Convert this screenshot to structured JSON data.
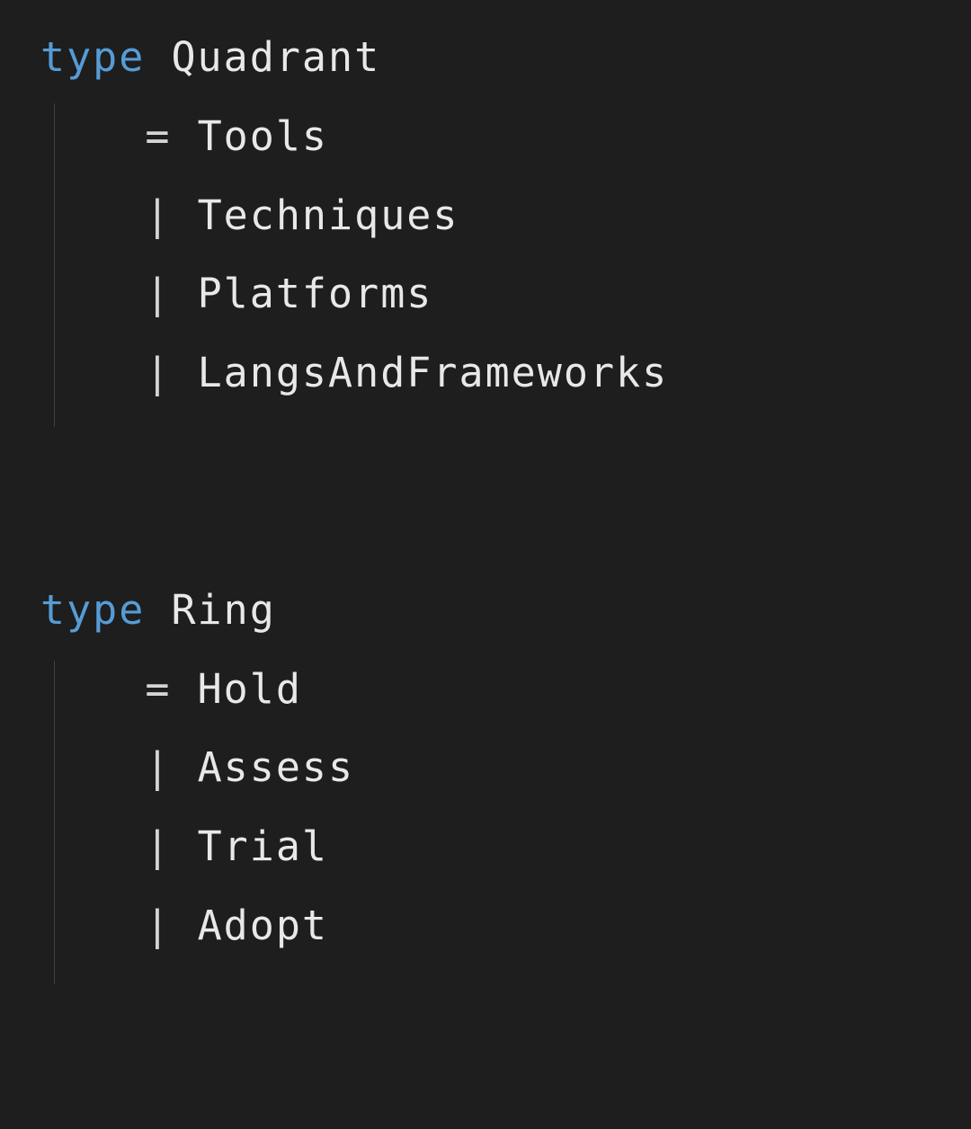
{
  "colors": {
    "background": "#1e1e1e",
    "keyword": "#569cd6",
    "text": "#e8e8e8",
    "punctuation": "#d4d4d4",
    "indentGuide": "#404040"
  },
  "code": {
    "keyword": "type",
    "types": [
      {
        "name": "Quadrant",
        "constructors": [
          "Tools",
          "Techniques",
          "Platforms",
          "LangsAndFrameworks"
        ]
      },
      {
        "name": "Ring",
        "constructors": [
          "Hold",
          "Assess",
          "Trial",
          "Adopt"
        ]
      }
    ],
    "equals": "=",
    "pipe": "|"
  }
}
